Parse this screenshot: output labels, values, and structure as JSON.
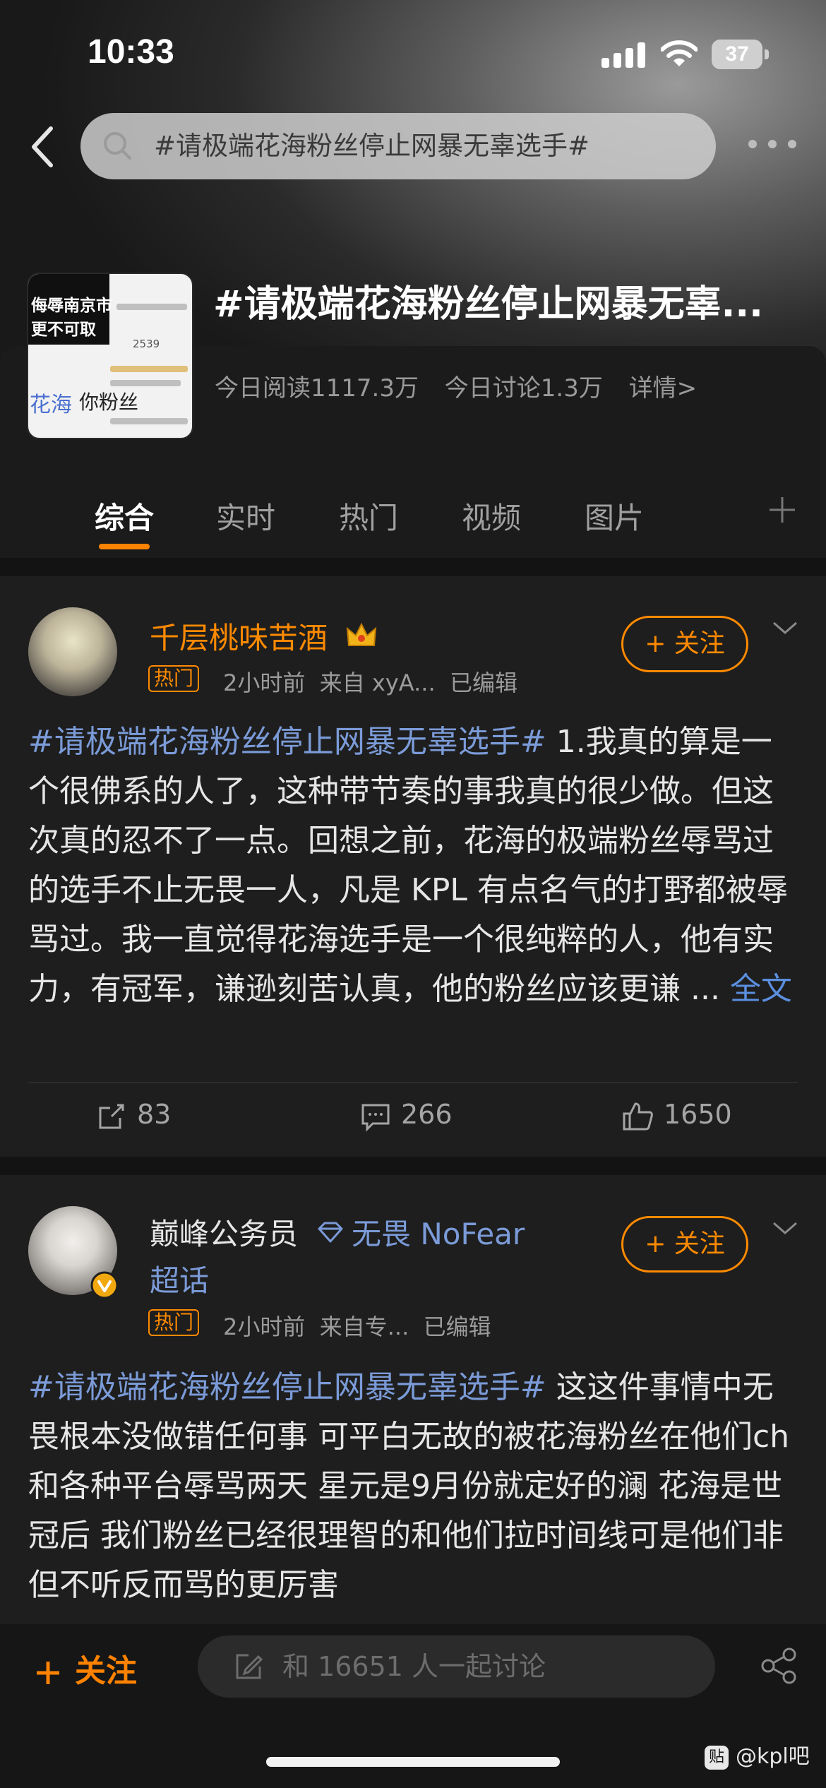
{
  "status_bar": {
    "time": "10:33",
    "battery": "37"
  },
  "search": {
    "query": "#请极端花海粉丝停止网暴无辜选手#"
  },
  "topic": {
    "title": "#请极端花海粉丝停止网暴无辜...",
    "reads_today": "今日阅读1117.3万",
    "discussions_today": "今日讨论1.3万",
    "details_link": "详情>",
    "thumbnail": {
      "caption_line1": "侮辱南京市",
      "caption_line2": "更不可取",
      "snippet_a": "花海",
      "snippet_b": "你粉丝",
      "snippet_c": "2539"
    }
  },
  "tabs": [
    {
      "label": "综合",
      "active": true
    },
    {
      "label": "实时"
    },
    {
      "label": "热门"
    },
    {
      "label": "视频"
    },
    {
      "label": "图片"
    }
  ],
  "posts": [
    {
      "username": "千层桃味苦酒",
      "badge": "热门",
      "time": "2小时前",
      "source": "来自 xyA...",
      "edited": "已编辑",
      "follow_label": "+ 关注",
      "hashtag": "#请极端花海粉丝停止网暴无辜选手#",
      "text": " 1.我真的算是一个很佛系的人了，这种带节奏的事我真的很少做。但这次真的忍不了一点。回想之前，花海的极端粉丝辱骂过的选手不止无畏一人，凡是 KPL 有点名气的打野都被辱骂过。我一直觉得花海选手是一个很纯粹的人，他有实力，有冠军，谦逊刻苦认真，他的粉丝应该更谦 ... ",
      "more_link": "全文",
      "reposts": "83",
      "comments": "266",
      "likes": "1650"
    },
    {
      "username": "巅峰公务员",
      "super_topic": "无畏 NoFear",
      "super_topic_suffix": "超话",
      "badge": "热门",
      "time": "2小时前",
      "source": "来自专...",
      "edited": "已编辑",
      "follow_label": "+ 关注",
      "hashtag": "#请极端花海粉丝停止网暴无辜选手#",
      "text": "  这这件事情中无畏根本没做错任何事 可平白无故的被花海粉丝在他们ch和各种平台辱骂两天 星元是9月份就定好的澜 花海是世冠后 我们粉丝已经很理智的和他们拉时间线可是他们非但不听反而骂的更厉害"
    }
  ],
  "bottom_bar": {
    "follow_label": "关注",
    "input_placeholder": "和 16651 人一起讨论"
  },
  "watermark": {
    "icon_text": "贴",
    "text": "@kpl吧"
  },
  "colors": {
    "accent": "#ff8200",
    "hashtag": "#7b9bd8",
    "link": "#5b8fe0"
  }
}
